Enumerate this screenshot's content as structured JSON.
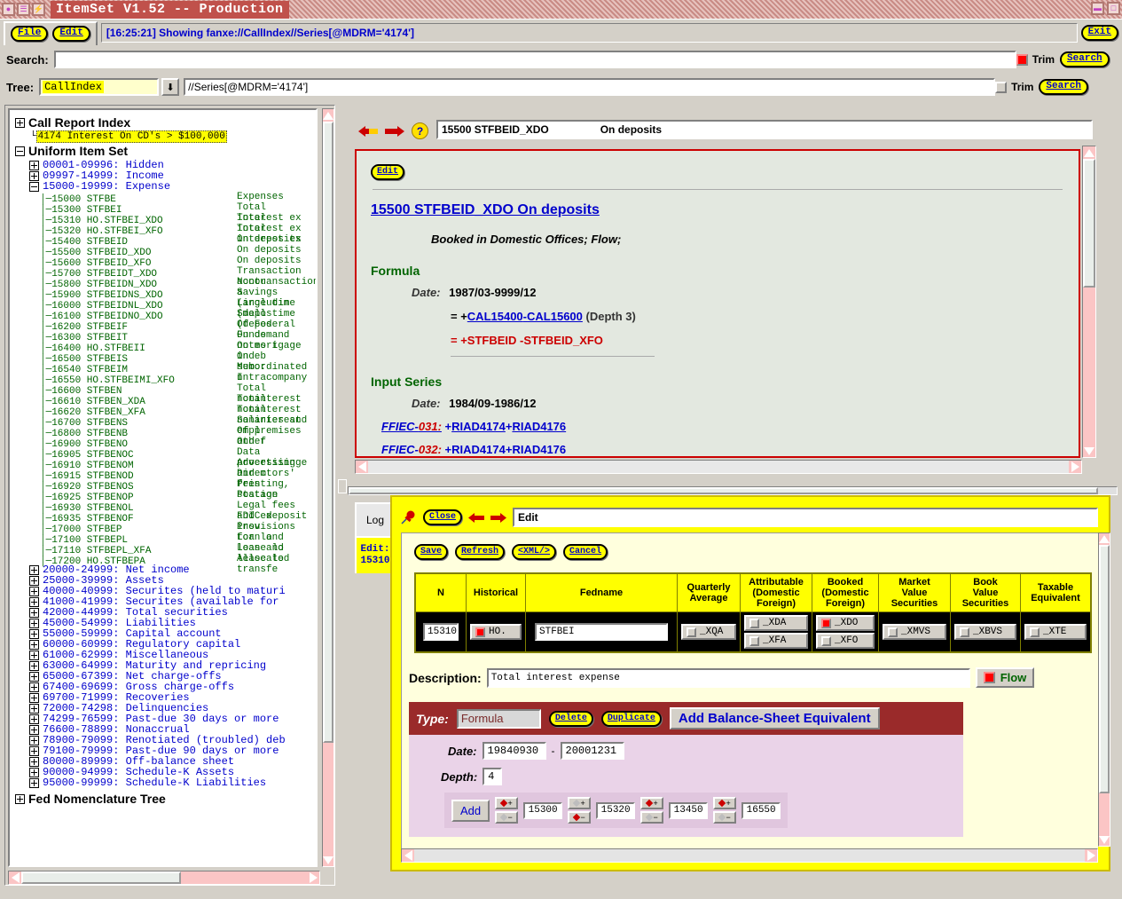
{
  "window": {
    "title": "ItemSet V1.52 -- Production",
    "icons": [
      "window-menu-icon",
      "restore-icon",
      "lightning-icon"
    ],
    "right_icons": [
      "minimize-icon",
      "maximize-icon"
    ]
  },
  "menubar": {
    "file_label": "File",
    "edit_label": "Edit",
    "status_text": "[16:25:21] Showing fanxe://CallIndex//Series[@MDRM='4174']",
    "exit_label": "Exit"
  },
  "search": {
    "label": "Search:",
    "value": "",
    "trim_label": "Trim",
    "trim_checked": true,
    "button_label": "Search"
  },
  "tree_search": {
    "label": "Tree:",
    "selected": "CallIndex",
    "xpath_value": "//Series[@MDRM='4174']",
    "trim_label": "Trim",
    "trim_checked": false,
    "button_label": "Search",
    "dropdown_icon": "chevron-down-icon"
  },
  "tree": {
    "roots": [
      {
        "label": "Call Report Index",
        "expanded": false
      },
      {
        "label": "Uniform Item Set",
        "expanded": true
      },
      {
        "label": "Fed Nomenclature Tree",
        "expanded": false
      }
    ],
    "highlighted_item": "4174 Interest On CD's > $100,000",
    "groups_before": [
      {
        "label": "00001-09996: Hidden",
        "expanded": false
      },
      {
        "label": "09997-14999: Income",
        "expanded": false
      },
      {
        "label": "15000-19999: Expense",
        "expanded": true
      }
    ],
    "leaves": [
      {
        "code": "15000",
        "name": "STFBE",
        "desc": "Expenses"
      },
      {
        "code": "15300",
        "name": "STFBEI",
        "desc": "Total interest ex"
      },
      {
        "code": "15310",
        "name": "HO.STFBEI_XDO",
        "desc": "Total interest ex"
      },
      {
        "code": "15320",
        "name": "HO.STFBEI_XFO",
        "desc": "Total interest ex"
      },
      {
        "code": "15400",
        "name": "STFBEID",
        "desc": "On deposits"
      },
      {
        "code": "15500",
        "name": "STFBEID_XDO",
        "desc": "On deposits"
      },
      {
        "code": "15600",
        "name": "STFBEID_XFO",
        "desc": "On deposits"
      },
      {
        "code": "15700",
        "name": "STFBEIDT_XDO",
        "desc": "Transaction accou"
      },
      {
        "code": "15800",
        "name": "STFBEIDN_XDO",
        "desc": "Nontransactions a"
      },
      {
        "code": "15900",
        "name": "STFBEIDNS_XDO",
        "desc": "Savings (includin"
      },
      {
        "code": "16000",
        "name": "STFBEIDNL_XDO",
        "desc": "Large time (depos"
      },
      {
        "code": "16100",
        "name": "STFBEIDNO_XDO",
        "desc": "Small time (depos"
      },
      {
        "code": "16200",
        "name": "STFBEIF",
        "desc": "Of Federal Funds"
      },
      {
        "code": "16300",
        "name": "STFBEIT",
        "desc": "On demand notes i"
      },
      {
        "code": "16400",
        "name": "HO.STFBEII",
        "desc": "On mortgage indeb"
      },
      {
        "code": "16500",
        "name": "STFBEIS",
        "desc": "On subordinated n"
      },
      {
        "code": "16540",
        "name": "STFBEIM",
        "desc": "Memo:"
      },
      {
        "code": "16550",
        "name": "HO.STFBEIMI_XFO",
        "desc": "Intracompany"
      },
      {
        "code": "16600",
        "name": "STFBEN",
        "desc": "Total noninterest"
      },
      {
        "code": "16610",
        "name": "STFBEN_XDA",
        "desc": "Total noninterest"
      },
      {
        "code": "16620",
        "name": "STFBEN_XFA",
        "desc": "Total noninterest"
      },
      {
        "code": "16700",
        "name": "STFBENS",
        "desc": "Salaries and empl"
      },
      {
        "code": "16800",
        "name": "STFBENB",
        "desc": "Of premises and f"
      },
      {
        "code": "16900",
        "name": "STFBENO",
        "desc": "Other"
      },
      {
        "code": "16905",
        "name": "STFBENOC",
        "desc": "Data processing e"
      },
      {
        "code": "16910",
        "name": "STFBENOM",
        "desc": "Advertising and m"
      },
      {
        "code": "16915",
        "name": "STFBENOD",
        "desc": "Directors' fees"
      },
      {
        "code": "16920",
        "name": "STFBENOS",
        "desc": "Printing, station"
      },
      {
        "code": "16925",
        "name": "STFBENOP",
        "desc": "Postage"
      },
      {
        "code": "16930",
        "name": "STFBENOL",
        "desc": "Legal fees and ex"
      },
      {
        "code": "16935",
        "name": "STFBENOF",
        "desc": "FDIC deposit insu"
      },
      {
        "code": "17000",
        "name": "STFBEP",
        "desc": "Provisions for lo"
      },
      {
        "code": "17100",
        "name": "STFBEPL",
        "desc": "Loan and lease lo"
      },
      {
        "code": "17110",
        "name": "STFBEPL_XFA",
        "desc": "Loan and lease lo"
      },
      {
        "code": "17200",
        "name": "HO.STFBEPA",
        "desc": "Allocated transfe"
      }
    ],
    "groups_after": [
      "20000-24999: Net income",
      "25000-39999: Assets",
      "40000-40999: Securites (held to maturi",
      "41000-41999: Securites (available for ",
      "42000-44999: Total securities",
      "45000-54999: Liabilities",
      "55000-59999: Capital account",
      "60000-60999: Regulatory capital",
      "61000-62999: Miscellaneous",
      "63000-64999: Maturity and repricing",
      "65000-67399: Net charge-offs",
      "67400-69699: Gross charge-offs",
      "69700-71999: Recoveries",
      "72000-74298: Delinquencies",
      "74299-76599: Past-due 30 days or more",
      "76600-78899: Nonaccrual",
      "78900-79099: Renotiated (troubled) deb",
      "79100-79999: Past-due 90 days or more",
      "80000-89999: Off-balance sheet",
      "90000-94999: Schedule-K Assets",
      "95000-99999: Schedule-K Liabilities"
    ]
  },
  "doc": {
    "nav_back_icon": "back-arrow-icon",
    "nav_fwd_icon": "forward-arrow-icon",
    "help_icon": "help-icon",
    "path_code": "15500 STFBEID_XDO",
    "path_desc": "On deposits",
    "edit_label": "Edit",
    "title": "15500 STFBEID_XDO On deposits",
    "subtitle": "Booked in Domestic Offices; Flow;",
    "formula_heading": "Formula",
    "formula_date_label": "Date:",
    "formula_date": "1987/03-9999/12",
    "formula_line1_prefix": "= +",
    "formula_line1_a": "CAL15400",
    "formula_line1_sep": "-",
    "formula_line1_b": "CAL15600",
    "formula_line1_depth": "(Depth 3)",
    "formula_line2": "= +STFBEID -STFBEID_XFO",
    "input_heading": "Input Series",
    "input_date_label": "Date:",
    "input_date": "1984/09-1986/12",
    "inputs": [
      {
        "form_prefix": "FFIEC-",
        "form_num": "031:",
        "expr_a": "+",
        "expr_b": "RIAD4174",
        "expr_c": "+",
        "expr_d": "RIAD4176"
      },
      {
        "form_prefix": "FFIEC-",
        "form_num": "032:",
        "expr_a": "+",
        "expr_b": "RIAD4174",
        "expr_c": "+",
        "expr_d": "RIAD4176"
      }
    ]
  },
  "edit": {
    "tabs": [
      {
        "label": "Log",
        "selected": false
      },
      {
        "label": "Edit:",
        "label2": "15310",
        "selected": true
      }
    ],
    "pin_icon": "pushpin-icon",
    "close_label": "Close",
    "back_icon": "back-arrow-icon",
    "fwd_icon": "forward-arrow-icon",
    "path_value": "Edit",
    "buttons": [
      "Save",
      "Refresh",
      "<XML/>",
      "Cancel"
    ],
    "table": {
      "headers": [
        "N",
        "Historical",
        "Fedname",
        "Quarterly Average",
        "Attributable (Domestic Foreign)",
        "Booked (Domestic Foreign)",
        "Market Value Securities",
        "Book Value Securities",
        "Taxable Equivalent"
      ],
      "row": {
        "n": "15310",
        "historical_label": "HO.",
        "historical_checked": true,
        "fedname": "STFBEI",
        "quarterly_average": {
          "label": "_XQA",
          "checked": false
        },
        "attributable": [
          {
            "label": "_XDA",
            "checked": false
          },
          {
            "label": "_XFA",
            "checked": false
          }
        ],
        "booked": [
          {
            "label": "_XDO",
            "checked": true
          },
          {
            "label": "_XFO",
            "checked": false
          }
        ],
        "market_value": {
          "label": "_XMVS",
          "checked": false
        },
        "book_value": {
          "label": "_XBVS",
          "checked": false
        },
        "taxable_equivalent": {
          "label": "_XTE",
          "checked": false
        }
      }
    },
    "description_label": "Description:",
    "description_value": "Total interest expense",
    "flow_label": "Flow",
    "flow_checked": true,
    "type_label": "Type:",
    "type_value": "Formula",
    "delete_label": "Delete",
    "duplicate_label": "Duplicate",
    "add_bse_label": "Add Balance-Sheet Equivalent",
    "date_label": "Date:",
    "date_from": "19840930",
    "date_sep": "-",
    "date_to": "20001231",
    "depth_label": "Depth:",
    "depth_value": "4",
    "add_label": "Add",
    "terms": [
      {
        "value": "15300",
        "sign": "plus"
      },
      {
        "value": "15320",
        "sign": "minus"
      },
      {
        "value": "13450",
        "sign": "plus"
      },
      {
        "value": "16550",
        "sign": "plus"
      }
    ]
  }
}
